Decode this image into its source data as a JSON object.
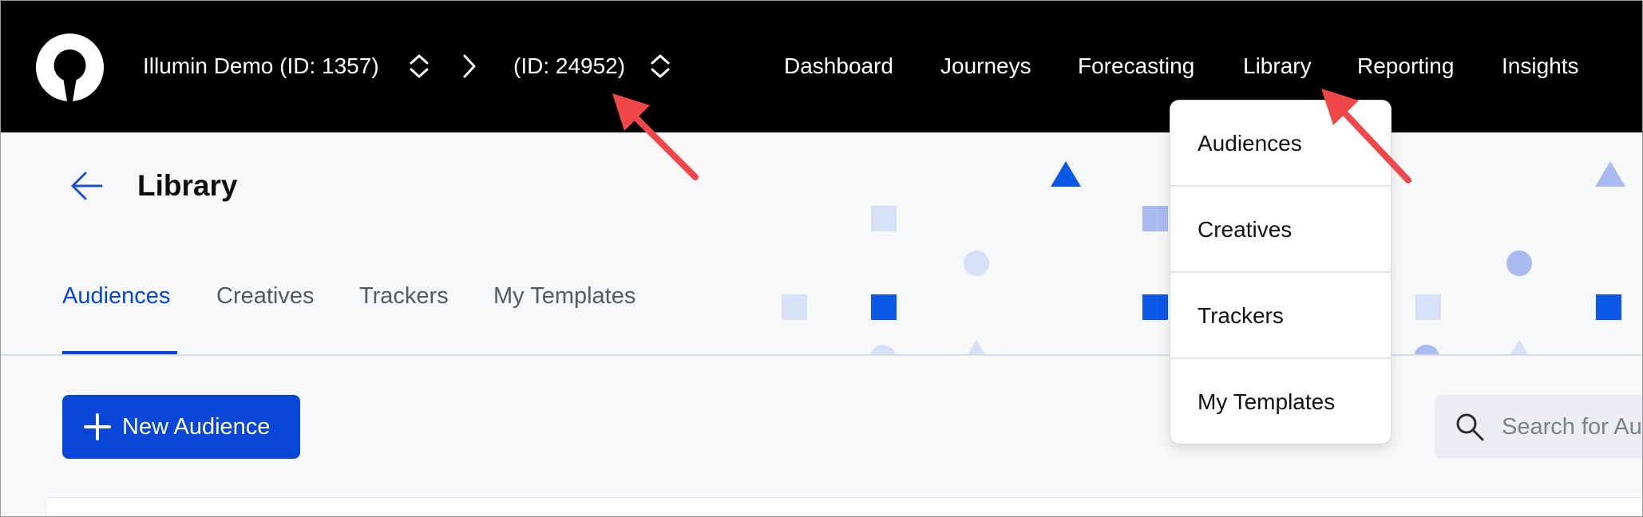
{
  "topbar": {
    "account_label": "Illumin Demo (ID: 1357)",
    "sub_account_label": "(ID: 24952)",
    "nav": [
      {
        "label": "Dashboard"
      },
      {
        "label": "Journeys"
      },
      {
        "label": "Forecasting"
      },
      {
        "label": "Library"
      },
      {
        "label": "Reporting"
      },
      {
        "label": "Insights"
      }
    ]
  },
  "page": {
    "title": "Library",
    "tabs": [
      {
        "label": "Audiences",
        "active": true
      },
      {
        "label": "Creatives"
      },
      {
        "label": "Trackers"
      },
      {
        "label": "My Templates"
      }
    ]
  },
  "actions": {
    "new_button_label": "New Audience",
    "search_placeholder": "Search for Audiences"
  },
  "library_menu": {
    "items": [
      {
        "label": "Audiences"
      },
      {
        "label": "Creatives"
      },
      {
        "label": "Trackers"
      },
      {
        "label": "My Templates"
      }
    ]
  },
  "colors": {
    "brand_blue": "#0846d8",
    "topbar_bg": "#000000",
    "annotation_red": "#f04848"
  },
  "icons": {
    "logo": "logo-icon",
    "stepper": "chevron-up-down-icon",
    "separator": "chevron-right-icon",
    "back": "arrow-left-icon",
    "plus": "plus-icon",
    "search": "search-icon"
  }
}
